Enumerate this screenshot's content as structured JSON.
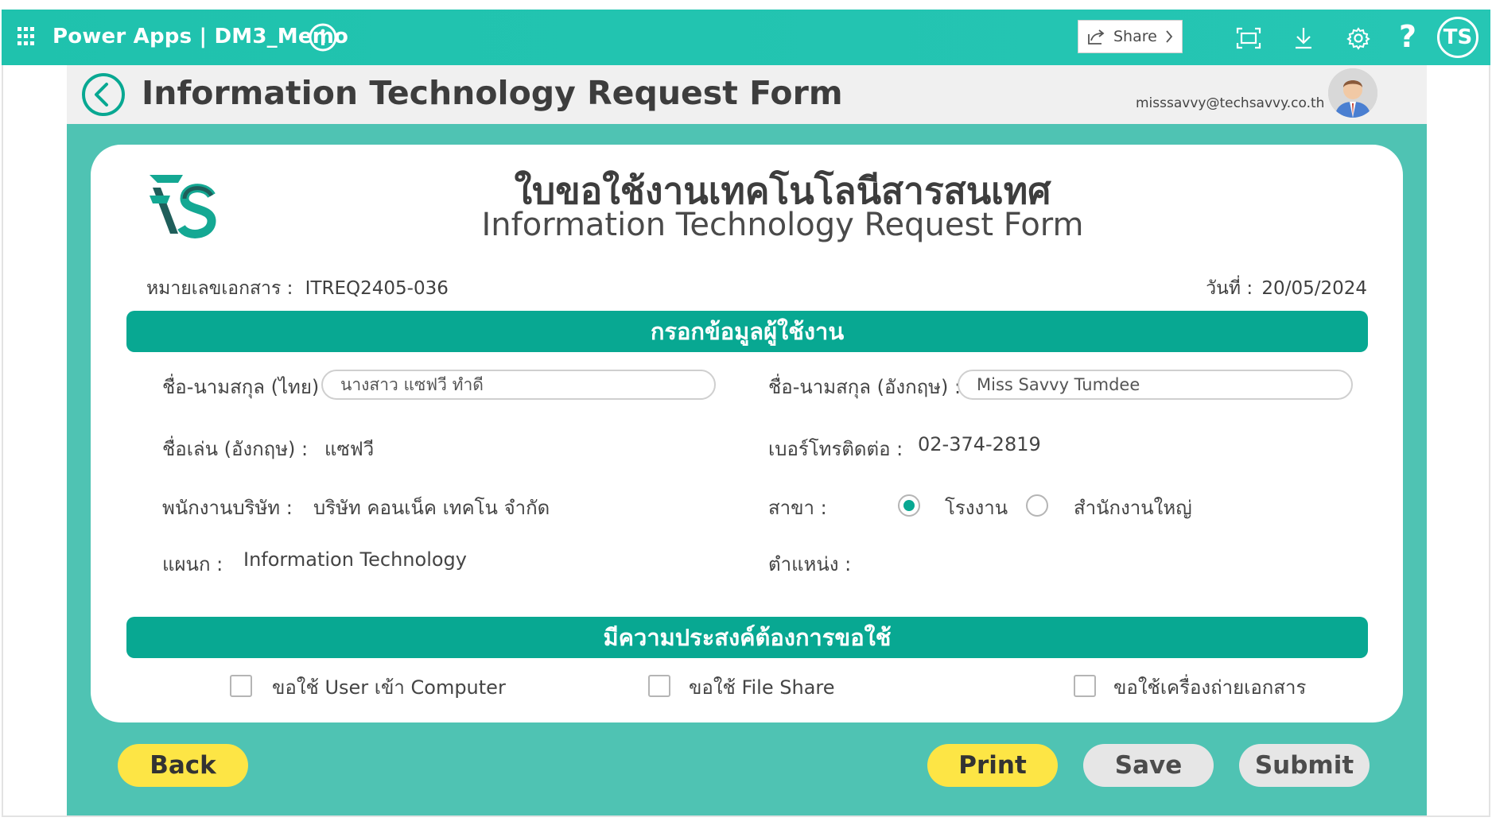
{
  "topbar": {
    "app_title": "Power Apps | DM3_Memo",
    "share_label": "Share",
    "help_glyph": "?",
    "user_initials": "TS",
    "icons": [
      "waffle-icon",
      "info-icon",
      "share-icon",
      "fit-screen-icon",
      "download-icon",
      "settings-icon",
      "help-icon"
    ]
  },
  "header": {
    "title": "Information Technology Request Form",
    "user_email": "misssavvy@techsavvy.co.th"
  },
  "form": {
    "title_th": "ใบขอใช้งานเทคโนโลนีสารสนเทศ",
    "title_en": "Information Technology Request Form",
    "doc_no_label": "หมายเลขเอกสาร :",
    "doc_no_value": "ITREQ2405-036",
    "date_label": "วันที่ :",
    "date_value": "20/05/2024",
    "section1_title": "กรอกข้อมูลผู้ใช้งาน",
    "name_th_label": "ชื่อ-นามสกุล (ไทย) :",
    "name_th_value": "นางสาว แซฟวี ทำดี",
    "name_en_label": "ชื่อ-นามสกุล (อังกฤษ) :",
    "name_en_value": "Miss Savvy  Tumdee",
    "nickname_label": "ชื่อเล่น (อังกฤษ) :",
    "nickname_value": "แซฟวี",
    "phone_label": "เบอร์โทรติดต่อ :",
    "phone_value": "02-374-2819",
    "company_label": "พนักงานบริษัท :",
    "company_value": "บริษัท คอนเน็ค เทคโน จำกัด",
    "branch_label": "สาขา :",
    "branch_options": [
      {
        "label": "โรงงาน",
        "selected": true
      },
      {
        "label": "สำนักงานใหญ่",
        "selected": false
      }
    ],
    "dept_label": "แผนก :",
    "dept_value": "Information Technology",
    "position_label": "ตำแหน่ง :",
    "position_value": "",
    "section2_title": "มีความประสงค์ต้องการขอใช้",
    "requests": [
      {
        "label": "ขอใช้ User เข้า Computer",
        "checked": false
      },
      {
        "label": "ขอใช้ File Share",
        "checked": false
      },
      {
        "label": "ขอใช้เครื่องถ่ายเอกสาร",
        "checked": false
      }
    ]
  },
  "buttons": {
    "back": "Back",
    "print": "Print",
    "save": "Save",
    "submit": "Submit"
  },
  "colors": {
    "topbar": "#26c6b4",
    "app_bg": "#4fc3b3",
    "section_bar": "#08a892",
    "yellow_button": "#fde545",
    "grey_button": "#e6e6e6"
  }
}
